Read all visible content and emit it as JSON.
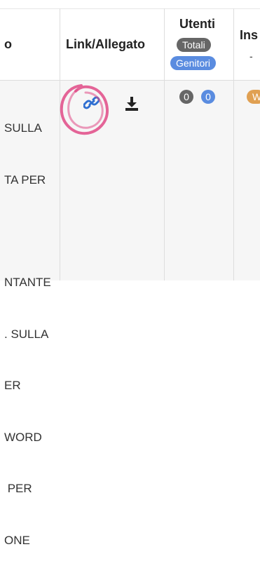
{
  "header": {
    "col1_partial": "o",
    "col2": "Link/Allegato",
    "col3": "Utenti",
    "col3_badges": [
      "Totali",
      "Genitori"
    ],
    "col4_partial": "Ins"
  },
  "row": {
    "text_lines": [
      "SULLA",
      "TA PER",
      "",
      "NTANTE",
      ". SULLA",
      "ER",
      "WORD",
      " PER",
      "ONE"
    ],
    "counts": [
      "0",
      "0"
    ],
    "col4_partial_badge": "W"
  },
  "icons": {
    "link": "link-icon",
    "download": "download-icon",
    "annotation": "hand-drawn-circle"
  },
  "colors": {
    "badge_dark": "#666666",
    "badge_blue": "#5a8ce0",
    "link_blue": "#2f6fd1",
    "orange_badge": "#e0a052",
    "annotation_pink": "#e04a86"
  }
}
